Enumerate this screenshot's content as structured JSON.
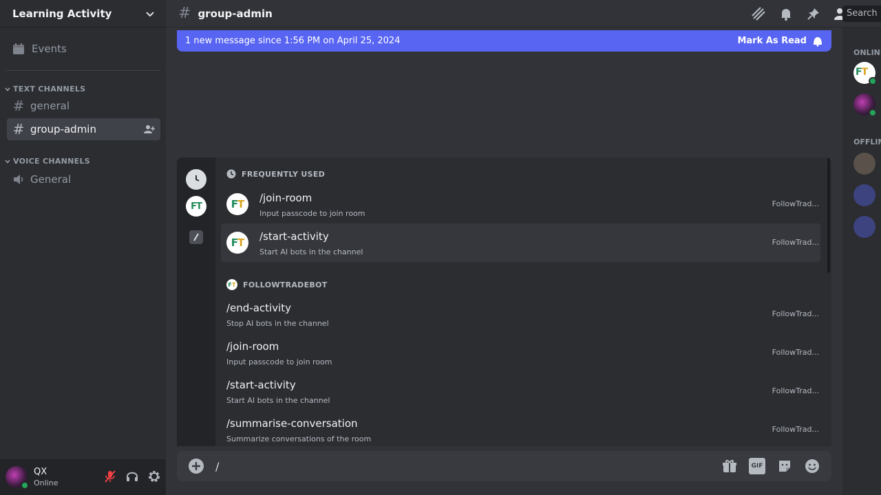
{
  "server": {
    "name": "Learning Activity",
    "events_label": "Events"
  },
  "categories": {
    "text": "TEXT CHANNELS",
    "voice": "VOICE CHANNELS"
  },
  "channels": {
    "text": [
      "general",
      "group-admin"
    ],
    "voice": [
      "General"
    ]
  },
  "active_channel": "group-admin",
  "header": {
    "channel": "group-admin",
    "search_placeholder": "Search"
  },
  "banner": {
    "text": "1 new message since 1:56 PM on April 25, 2024",
    "action": "Mark As Read"
  },
  "members": {
    "online_label": "ONLINE",
    "offline_label": "OFFLINE"
  },
  "popup": {
    "frequent_header": "FREQUENTLY USED",
    "bot_header": "FOLLOWTRADEBOT",
    "bot_initials": "FT",
    "frequent": [
      {
        "name": "/join-room",
        "desc": "Input passcode to join room",
        "source": "FollowTrad..."
      },
      {
        "name": "/start-activity",
        "desc": "Start AI bots in the channel",
        "source": "FollowTrad..."
      }
    ],
    "bot": [
      {
        "name": "/end-activity",
        "desc": "Stop AI bots in the channel",
        "source": "FollowTrad..."
      },
      {
        "name": "/join-room",
        "desc": "Input passcode to join room",
        "source": "FollowTrad..."
      },
      {
        "name": "/start-activity",
        "desc": "Start AI bots in the channel",
        "source": "FollowTrad..."
      },
      {
        "name": "/summarise-conversation",
        "desc": "Summarize conversations of the room",
        "source": "FollowTrad..."
      }
    ]
  },
  "composer": {
    "value": "/"
  },
  "user": {
    "name": "QX",
    "status": "Online"
  },
  "colors": {
    "accent": "#5865f2",
    "online": "#23a55a",
    "mute": "#f23f43"
  }
}
